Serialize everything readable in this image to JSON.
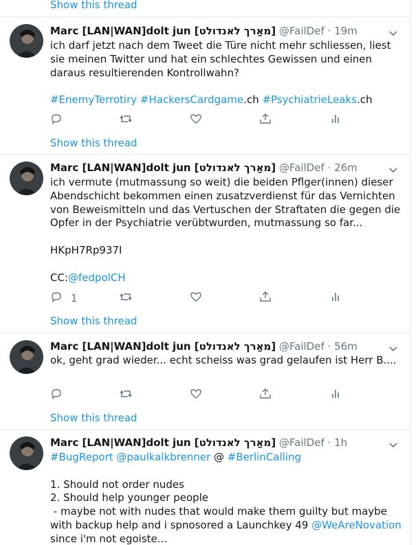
{
  "thread_link_label": "Show this thread",
  "author": {
    "name": "Marc [LAN|WAN]dolt jun [מאַרך לאנדולט]",
    "handle": "@FailDef"
  },
  "tweets": [
    {
      "time": "19m",
      "paragraphs": [
        [
          {
            "t": "ich darf jetzt nach dem Tweet die Türe nicht mehr schliessen, liest sie meinen Twitter und hat ein schlechtes Gewissen und einen daraus resultierenden Kontrollwahn?"
          }
        ],
        [
          {
            "t": "#EnemyTerrotiry",
            "link": true
          },
          {
            "t": " "
          },
          {
            "t": "#HackersCardgame",
            "link": true
          },
          {
            "t": ".ch "
          },
          {
            "t": "#PsychiatrieLeaks",
            "link": true
          },
          {
            "t": ".ch"
          }
        ]
      ],
      "reply_count": ""
    },
    {
      "time": "26m",
      "paragraphs": [
        [
          {
            "t": "ich vermute (mutmassung so weit) die beiden Pflger(innen) dieser Abendschicht bekommen einen zusatzverdienst für das Vernichten von Beweismitteln und das Vertuschen der Straftaten die gegen die Opfer in der Psychiatrie verübtwurden, mutmassung so far..."
          }
        ],
        [
          {
            "t": "HKpH7Rp937I"
          }
        ],
        [
          {
            "t": "CC:"
          },
          {
            "t": "@fedpolCH",
            "link": true
          }
        ]
      ],
      "reply_count": "1"
    },
    {
      "time": "56m",
      "paragraphs": [
        [
          {
            "t": "ok, geht grad wieder... echt scheiss was grad gelaufen ist Herr B...."
          }
        ]
      ],
      "reply_count": ""
    },
    {
      "time": "1h",
      "paragraphs": [
        [
          {
            "t": "#BugReport",
            "link": true
          },
          {
            "t": " "
          },
          {
            "t": "@paulkalkbrenner",
            "link": true
          },
          {
            "t": " @ "
          },
          {
            "t": "#BerlinCalling",
            "link": true
          }
        ],
        [
          {
            "t": "1. Should not order nudes\n2. Should help younger people\n - maybe not with nudes that would make them guilty but maybe with backup help and i spnosored a Launchkey 49 "
          },
          {
            "t": "@WeAreNovation",
            "link": true
          },
          {
            "t": " since i'm not egoiste..."
          }
        ]
      ],
      "reply_count": ""
    }
  ],
  "icons": {
    "reply": "reply-icon",
    "retweet": "retweet-icon",
    "like": "like-icon",
    "share": "share-icon",
    "analytics": "analytics-icon",
    "menu": "chevron-down-icon"
  },
  "colors": {
    "link": "#1b95e0",
    "secondary_text": "#657786",
    "divider": "#e6ecf0"
  }
}
